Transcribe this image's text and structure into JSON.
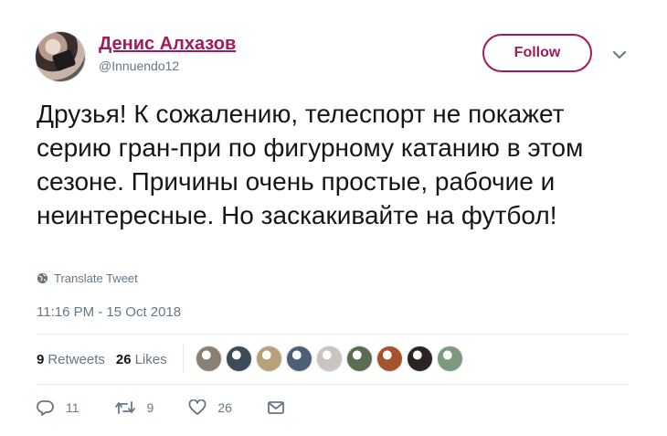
{
  "author": {
    "name": "Денис Алхазов",
    "handle": "@Innuendo12"
  },
  "follow_label": "Follow",
  "tweet": {
    "text": "Друзья! К сожалению, телеспорт не покажет серию гран-при по фигурному катанию в этом сезоне. Причины очень простые, рабочие и неинтересные. Но заскакивайте на футбол!",
    "translate_label": "Translate Tweet",
    "timestamp": "11:16 PM - 15 Oct 2018"
  },
  "stats": {
    "retweets_count": "9",
    "retweets_label": "Retweets",
    "likes_count": "26",
    "likes_label": "Likes"
  },
  "likers": [
    {
      "color": "#8a7f72"
    },
    {
      "color": "#3d4a57"
    },
    {
      "color": "#b9a07a"
    },
    {
      "color": "#4d5f75"
    },
    {
      "color": "#c9c4c0"
    },
    {
      "color": "#5a6d52"
    },
    {
      "color": "#a4532c"
    },
    {
      "color": "#2b2422"
    },
    {
      "color": "#7c9a7e"
    }
  ],
  "actions": {
    "reply_count": "11",
    "retweet_count": "9",
    "like_count": "26"
  },
  "colors": {
    "accent": "#a3195b",
    "muted": "#657786"
  },
  "icons": [
    "chevron-down-icon",
    "globe-icon",
    "reply-icon",
    "retweet-icon",
    "heart-icon",
    "message-icon"
  ]
}
